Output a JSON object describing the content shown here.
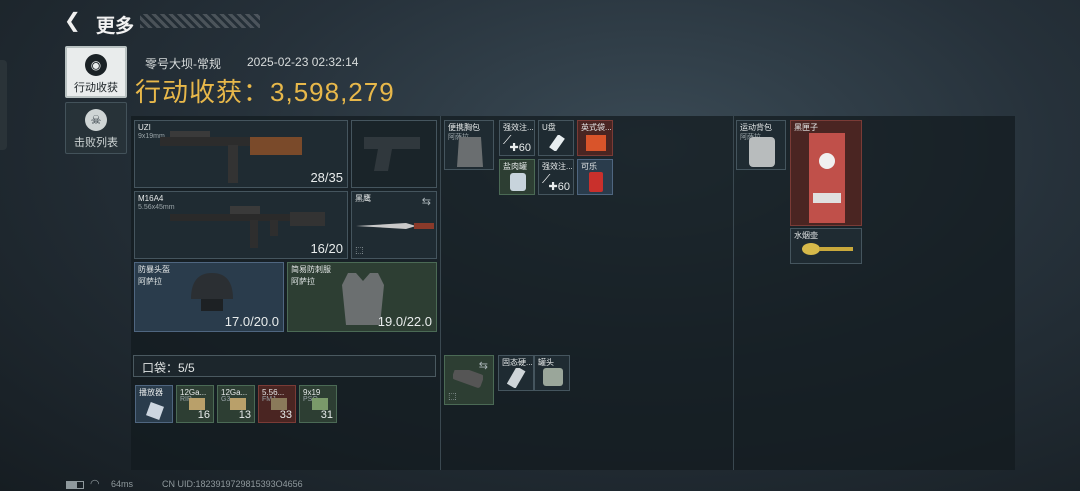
{
  "header": {
    "title": "更多"
  },
  "nav": [
    {
      "label": "行动收获",
      "icon": "coin-icon"
    },
    {
      "label": "击败列表",
      "icon": "skull-icon"
    }
  ],
  "info": {
    "map": "零号大坝-常规",
    "datetime": "2025-02-23 02:32:14",
    "harvest_label": "行动收获：",
    "harvest_value": "3,598,279"
  },
  "weapons": [
    {
      "name": "UZI",
      "sub": "9x19mm",
      "ammo": "28/35"
    },
    {
      "name": "M16A4",
      "sub": "5.56x45mm",
      "ammo": "16/20"
    }
  ],
  "melee": {
    "name": "黑鹰"
  },
  "armor": [
    {
      "name": "防暴头盔",
      "sub": "阿萨拉",
      "durability": "17.0/20.0"
    },
    {
      "name": "简易防刺服",
      "sub": "阿萨拉",
      "durability": "19.0/22.0"
    }
  ],
  "pocket": {
    "label": "口袋：5/5",
    "items": [
      {
        "name": "播放器",
        "sub": "",
        "count": ""
      },
      {
        "name": "12Ga...",
        "sub": "RIP",
        "count": "16"
      },
      {
        "name": "12Ga...",
        "sub": "G3",
        "count": "13"
      },
      {
        "name": "5.56...",
        "sub": "FMJ",
        "count": "33"
      },
      {
        "name": "9x19",
        "sub": "PSO",
        "count": "31"
      }
    ]
  },
  "chest_rig": {
    "name": "便携胸包",
    "sub": "阿萨拉",
    "items": [
      {
        "name": "强效注...",
        "count": "60"
      },
      {
        "name": "U盘",
        "count": ""
      },
      {
        "name": "英式袋...",
        "count": ""
      },
      {
        "name": "盐肉罐",
        "count": ""
      },
      {
        "name": "强效注...",
        "count": "60"
      },
      {
        "name": "可乐",
        "count": ""
      }
    ]
  },
  "secure": {
    "items": [
      {
        "name": "固态硬...",
        "count": ""
      },
      {
        "name": "罐头",
        "count": ""
      }
    ]
  },
  "backpack": {
    "name": "运动背包",
    "sub": "阿萨拉",
    "items": [
      {
        "name": "黑匣子"
      },
      {
        "name": "水烟壶"
      }
    ]
  },
  "footer": {
    "ping": "64ms",
    "uid": "CN UID:1823919729815393O4656"
  }
}
